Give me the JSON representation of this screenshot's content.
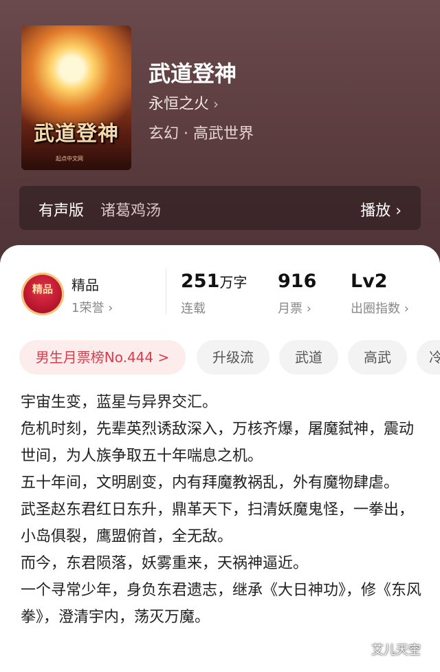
{
  "header": {
    "cover_title": "武道登神",
    "cover_publisher": "起点中文网",
    "title": "武道登神",
    "author": "永恒之火",
    "author_chevron": "›",
    "genre": "玄幻 · 高武世界"
  },
  "audio": {
    "tag": "有声版",
    "narrator": "诸葛鸡汤",
    "play_label": "播放 ›"
  },
  "stats": {
    "badge_text": "精品",
    "quality_label": "精品",
    "honor": "1荣誉 ›",
    "words_value": "251",
    "words_unit": "万字",
    "status": "连载",
    "monthly_votes": "916",
    "monthly_votes_label": "月票 ›",
    "level": "Lv2",
    "level_label": "出圈指数 ›"
  },
  "tags": [
    {
      "label": "男生月票榜No.444 >"
    },
    {
      "label": "升级流"
    },
    {
      "label": "武道"
    },
    {
      "label": "高武"
    },
    {
      "label": "冷"
    }
  ],
  "description": [
    "宇宙生变，蓝星与异界交汇。",
    "危机时刻，先辈英烈诱敌深入，万核齐爆，屠魔弑神，震动世间，为人族争取五十年喘息之机。",
    "五十年间，文明剧变，内有拜魔教祸乱，外有魔物肆虐。",
    "武圣赵东君红日东升，鼎革天下，扫清妖魔鬼怪，一拳出，小岛俱裂，鹰盟俯首，全无敌。",
    "而今，东君陨落，妖雾重来，天祸神逼近。",
    "一个寻常少年，身负东君遗志，继承《大日神功》，修《东风拳》，澄清宇内，荡灭万魔。"
  ],
  "watermark": "艾儿天空"
}
